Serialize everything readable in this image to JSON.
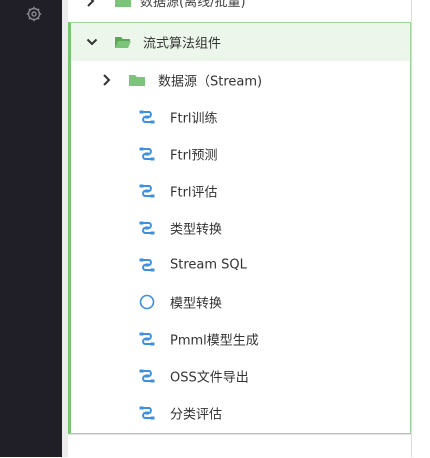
{
  "tree": {
    "top_cutoff_item": {
      "label": "数据源(离线/批量)",
      "icon": "folder-icon"
    },
    "group": {
      "label": "流式算法组件",
      "expanded": true,
      "icon": "folder-open-icon",
      "children": [
        {
          "label": "数据源（Stream)",
          "type": "folder",
          "icon": "folder-icon"
        },
        {
          "label": "Ftrl训练",
          "type": "component",
          "icon": "component-node-icon"
        },
        {
          "label": "Ftrl预测",
          "type": "component",
          "icon": "component-node-icon"
        },
        {
          "label": "Ftrl评估",
          "type": "component",
          "icon": "component-node-icon"
        },
        {
          "label": "类型转换",
          "type": "component",
          "icon": "component-node-icon"
        },
        {
          "label": "Stream SQL",
          "type": "component",
          "icon": "component-node-icon"
        },
        {
          "label": "模型转换",
          "type": "component",
          "icon": "circle-icon"
        },
        {
          "label": "Pmml模型生成",
          "type": "component",
          "icon": "component-node-icon"
        },
        {
          "label": "OSS文件导出",
          "type": "component",
          "icon": "component-node-icon"
        },
        {
          "label": "分类评估",
          "type": "component",
          "icon": "component-node-icon"
        }
      ]
    }
  },
  "sidebar": {
    "icon": "gear-icon"
  },
  "colors": {
    "accent_green": "#79c574",
    "header_bg": "#ecf6ea",
    "component_icon_blue": "#3d8fe0",
    "folder_green": "#7cc47a",
    "dark_bar": "#201e26"
  }
}
